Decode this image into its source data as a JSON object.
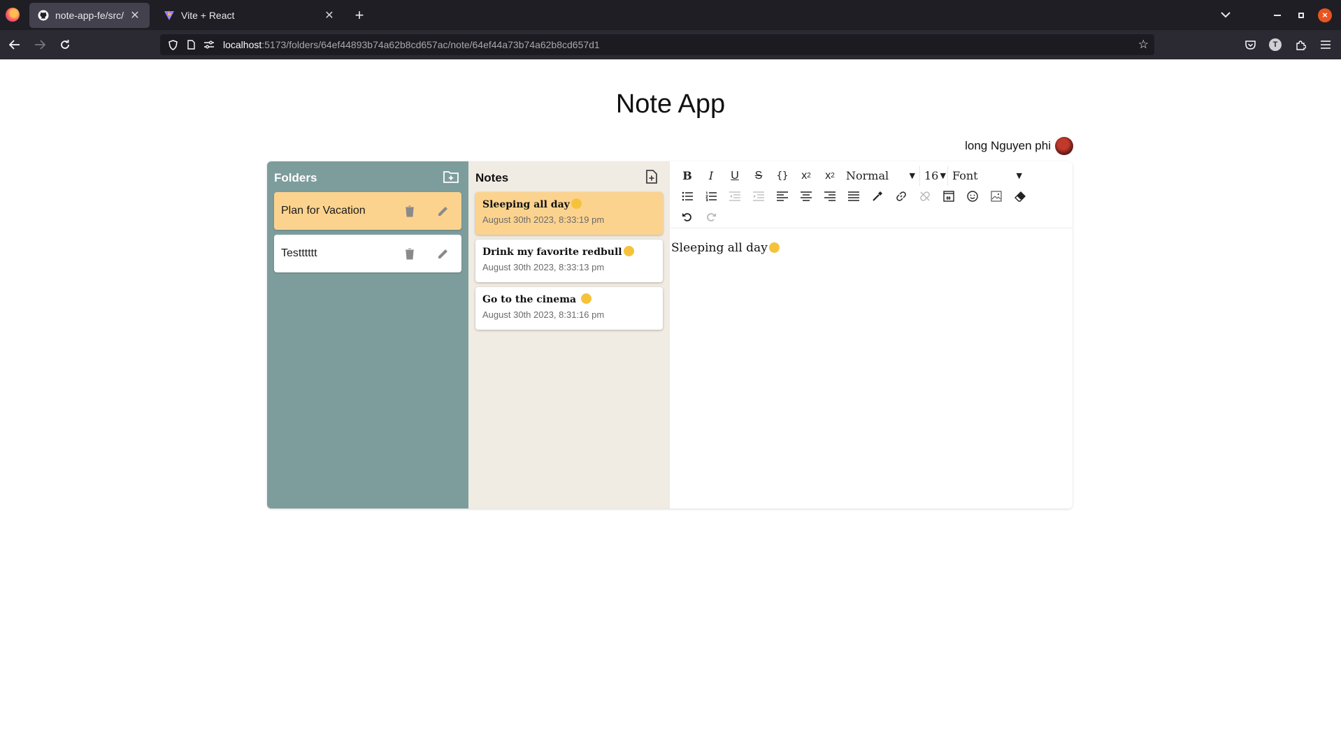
{
  "browser": {
    "tabs": [
      {
        "title": "note-app-fe/src/utils/note",
        "active": true
      },
      {
        "title": "Vite + React",
        "active": false
      }
    ],
    "url": {
      "host": "localhost",
      "rest": ":5173/folders/64ef44893b74a62b8cd657ac/note/64ef44a73b74a62b8cd657d1"
    }
  },
  "app": {
    "title": "Note App",
    "user_name": "long Nguyen phi"
  },
  "folders": {
    "heading": "Folders",
    "items": [
      {
        "name": "Plan for Vacation",
        "selected": true
      },
      {
        "name": "Testttttt",
        "selected": false
      }
    ]
  },
  "notes": {
    "heading": "Notes",
    "items": [
      {
        "title": "Sleeping all day",
        "date": "August 30th 2023, 8:33:19 pm",
        "selected": true
      },
      {
        "title": "Drink my favorite redbull",
        "date": "August 30th 2023, 8:33:13 pm",
        "selected": false
      },
      {
        "title": "Go to the cinema ",
        "date": "August 30th 2023, 8:31:16 pm",
        "selected": false
      }
    ]
  },
  "editor": {
    "block_type": "Normal",
    "font_size": "16",
    "font_family": "Font",
    "content": "Sleeping all day"
  },
  "colors": {
    "folders_bg": "#7d9d9c",
    "notes_bg": "#f0ebe3",
    "selected_bg": "#fcd38e"
  }
}
